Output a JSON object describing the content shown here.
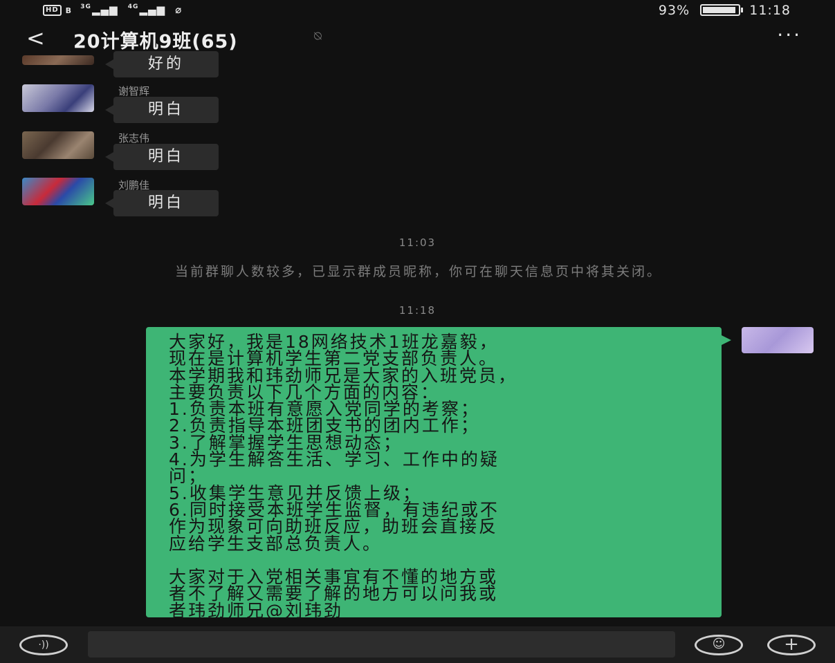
{
  "status_bar": {
    "hd": "HD",
    "sim": "B",
    "net1": "3G",
    "net2": "4G",
    "battery": "93%",
    "battery_level": 0.93,
    "time": "11:18"
  },
  "header": {
    "back_icon": "‹",
    "title": "20计算机9班(65)",
    "mute_icon": "bell-off-icon",
    "more_icon": "···"
  },
  "messages": [
    {
      "sender": "",
      "text": "好的"
    },
    {
      "sender": "谢智辉",
      "text": "明白"
    },
    {
      "sender": "张志伟",
      "text": "明白"
    },
    {
      "sender": "刘鹏佳",
      "text": "明白"
    }
  ],
  "time_1": "11:03",
  "system_notice": "当前群聊人数较多，已显示群成员昵称，你可在聊天信息页中将其关闭。",
  "time_2": "11:18",
  "own_message": "大家好，我是18网络技术1班龙嘉毅，\n现在是计算机学生第二党支部负责人。\n本学期我和玮劲师兄是大家的入班党员，\n主要负责以下几个方面的内容：\n1.负责本班有意愿入党同学的考察；\n2.负责指导本班团支书的团内工作；\n3.了解掌握学生思想动态；\n4.为学生解答生活、学习、工作中的疑\n问；\n5.收集学生意见并反馈上级；\n6.同时接受本班学生监督，有违纪或不\n作为现象可向助班反应，助班会直接反\n应给学生支部总负责人。\n\n大家对于入党相关事宜有不懂的地方或\n者不了解又需要了解的地方可以问我或\n者玮劲师兄@刘玮劲",
  "colors": {
    "background": "#111111",
    "incoming_bubble": "#2c2c2c",
    "outgoing_bubble": "#3eb575"
  }
}
